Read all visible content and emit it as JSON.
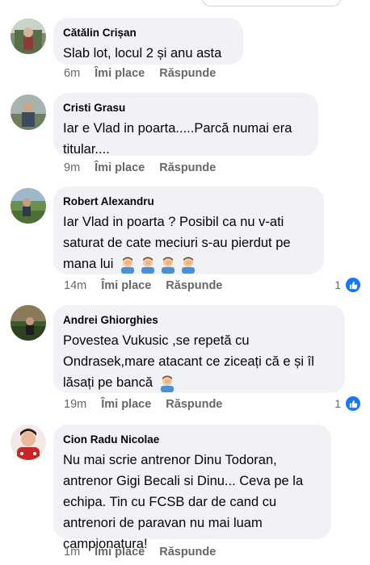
{
  "comments": [
    {
      "author": "Cătălin Crișan",
      "text": "Slab lot, locul 2 și anu asta",
      "time": "6m",
      "like": "Îmi place",
      "reply": "Răspunde"
    },
    {
      "author": "Cristi Grasu",
      "text": "Iar e Vlad in poarta.....Parcă numai era titular....",
      "time": "9m",
      "like": "Îmi place",
      "reply": "Răspunde"
    },
    {
      "author": "Robert Alexandru",
      "text": "Iar Vlad in poarta ? Posibil ca nu v-ati saturat de cate meciuri s-au pierdut pe mana lui",
      "time": "14m",
      "like": "Îmi place",
      "reply": "Răspunde",
      "reaction_count": "1"
    },
    {
      "author": "Andrei Ghiorghies",
      "text": "Povestea Vukusic ,se repetă cu Ondrasek,mare atacant ce ziceați că e și îl lăsați pe bancă",
      "time": "19m",
      "like": "Îmi place",
      "reply": "Răspunde",
      "reaction_count": "1"
    },
    {
      "author": "Cion Radu Nicolae",
      "text": "Nu mai scrie antrenor Dinu Todoran, antrenor Gigi Becali si Dinu... Ceva pe la echipa. Tin cu FCSB dar de cand cu antrenori de paravan nu mai luam campionatura!",
      "time": "1m",
      "like": "Îmi place",
      "reply": "Răspunde"
    }
  ],
  "colors": {
    "bubble": "#f0f2f5",
    "secondary_text": "#65676b",
    "like_blue": "#1877f2"
  },
  "icons": {
    "facepalm": "man-facepalming-emoji",
    "like": "thumbs-up-icon"
  }
}
